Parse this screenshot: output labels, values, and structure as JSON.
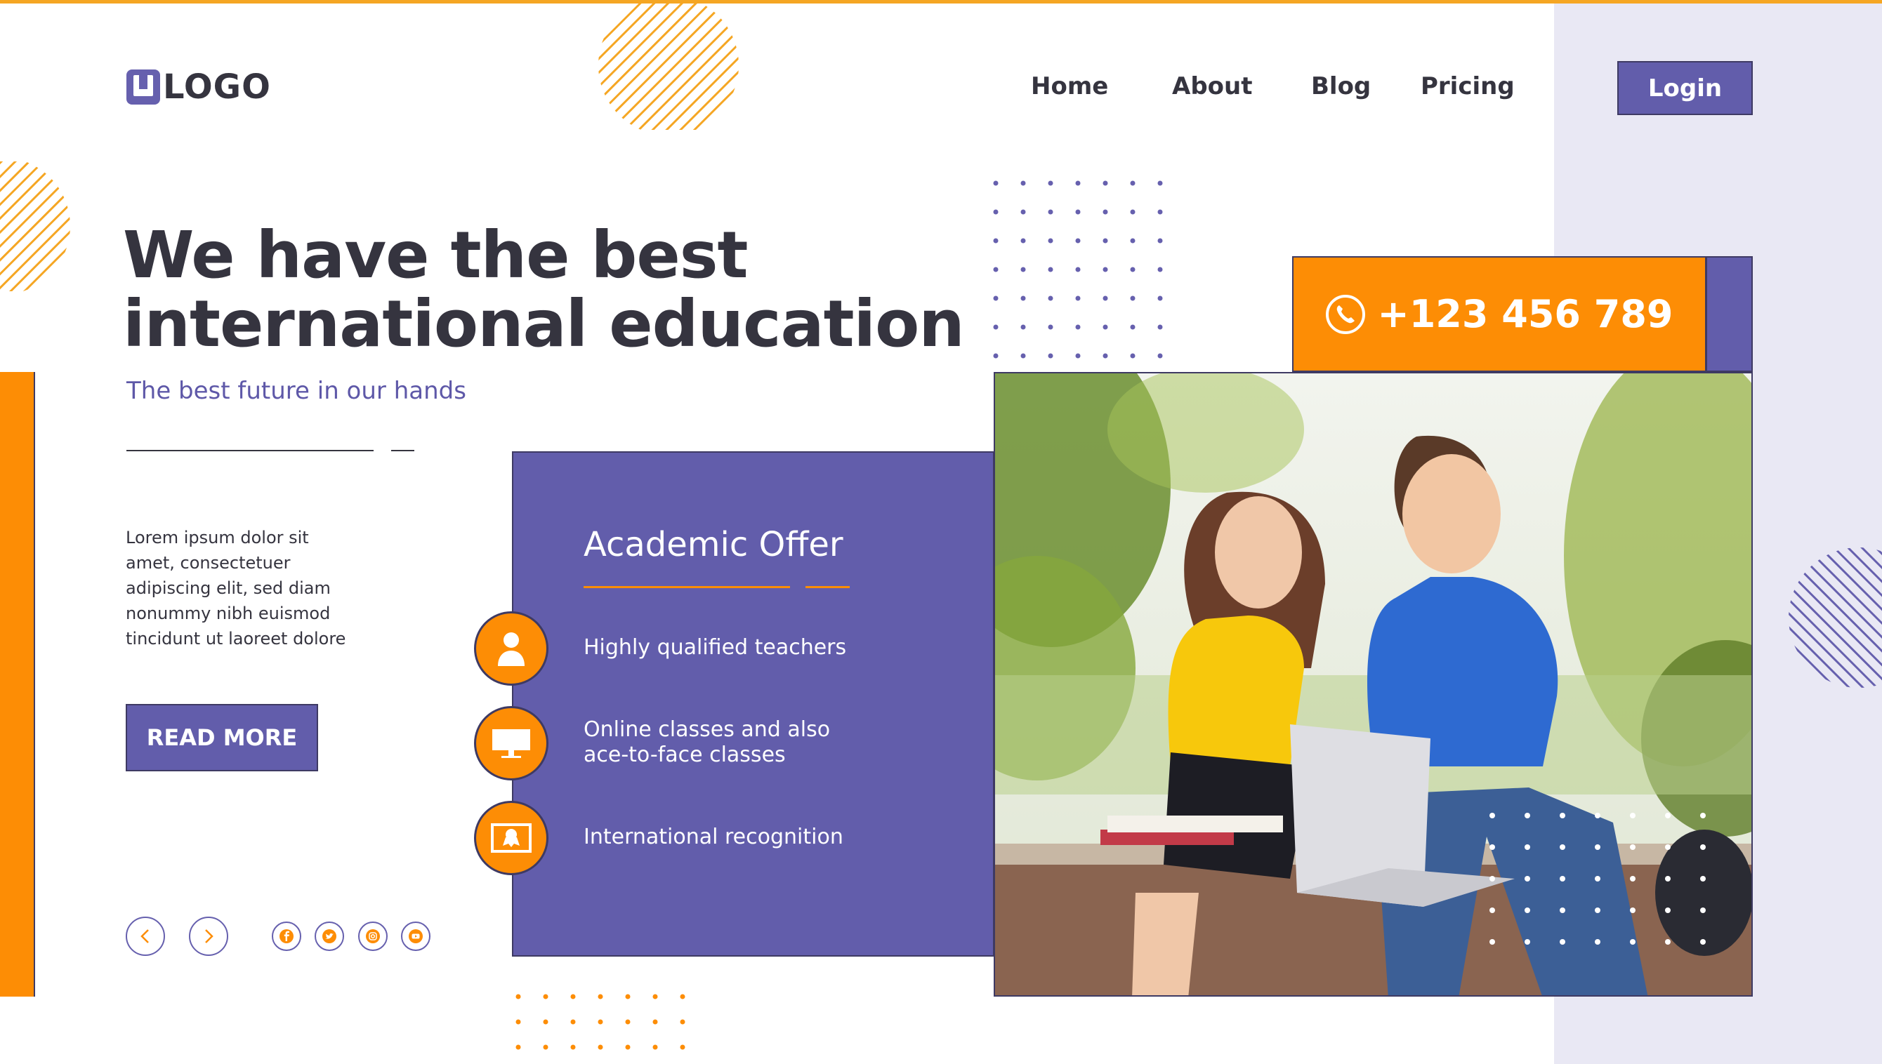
{
  "brand": {
    "logo_text": "LOGO"
  },
  "nav": {
    "items": [
      "Home",
      "About",
      "Blog",
      "Pricing"
    ],
    "login_label": "Login"
  },
  "hero": {
    "headline_line1": "We have the best",
    "headline_line2": "international education",
    "subheadline": "The best future in our hands",
    "body_lines": [
      "Lorem ipsum dolor sit",
      "amet, consectetuer",
      "adipiscing elit, sed diam",
      "nonummy nibh euismod",
      "tincidunt ut laoreet dolore"
    ],
    "cta_label": "READ MORE"
  },
  "offer": {
    "title": "Academic Offer",
    "features": [
      {
        "icon": "teacher-icon",
        "lines": [
          "Highly qualified teachers"
        ]
      },
      {
        "icon": "monitor-icon",
        "lines": [
          "Online classes and also",
          "ace-to-face classes"
        ]
      },
      {
        "icon": "certificate-icon",
        "lines": [
          "International recognition"
        ]
      }
    ]
  },
  "contact": {
    "phone": "+123 456 789",
    "icon": "phone-icon"
  },
  "controls": {
    "arrows": [
      "chevron-left-icon",
      "chevron-right-icon"
    ],
    "social": [
      "facebook-icon",
      "twitter-icon",
      "instagram-icon",
      "youtube-icon"
    ]
  },
  "colors": {
    "orange": "#fd8d05",
    "purple": "#625dab",
    "navy_text": "#35343f",
    "panel": "#e9e8f4",
    "top_line": "#f5a623"
  }
}
